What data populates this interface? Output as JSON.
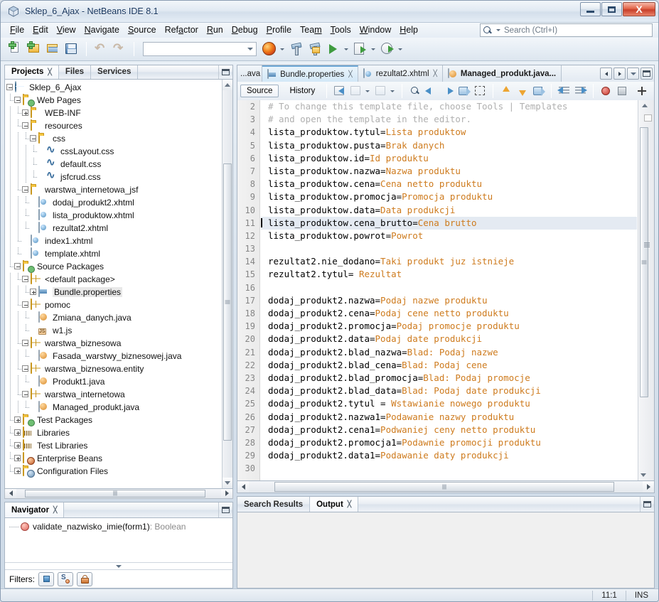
{
  "window": {
    "title": "Sklep_6_Ajax - NetBeans IDE 8.1",
    "app_icon": "netbeans-cube-icon",
    "minimize_label": "Minimize",
    "maximize_label": "Maximize",
    "close_label": "X"
  },
  "menubar": {
    "items": [
      {
        "label": "File",
        "mnemonic": "F"
      },
      {
        "label": "Edit",
        "mnemonic": "E"
      },
      {
        "label": "View",
        "mnemonic": "V"
      },
      {
        "label": "Navigate",
        "mnemonic": "N"
      },
      {
        "label": "Source",
        "mnemonic": "S"
      },
      {
        "label": "Refactor",
        "mnemonic": "a"
      },
      {
        "label": "Run",
        "mnemonic": "R"
      },
      {
        "label": "Debug",
        "mnemonic": "D"
      },
      {
        "label": "Profile",
        "mnemonic": "P"
      },
      {
        "label": "Team",
        "mnemonic": "m"
      },
      {
        "label": "Tools",
        "mnemonic": "T"
      },
      {
        "label": "Window",
        "mnemonic": "W"
      },
      {
        "label": "Help",
        "mnemonic": "H"
      }
    ]
  },
  "search": {
    "placeholder": "Search (Ctrl+I)",
    "value": "",
    "icon": "search-icon"
  },
  "toolbar": {
    "buttons": [
      {
        "name": "new-file-button",
        "icon": "new-file-icon"
      },
      {
        "name": "new-project-button",
        "icon": "new-project-icon"
      },
      {
        "name": "open-project-button",
        "icon": "open-project-icon"
      },
      {
        "name": "save-all-button",
        "icon": "save-all-icon"
      },
      {
        "name": "undo-button",
        "icon": "undo-icon"
      },
      {
        "name": "redo-button",
        "icon": "redo-icon"
      }
    ],
    "config_combo_value": "",
    "run_buttons": [
      {
        "name": "browser-button",
        "icon": "firefox-icon"
      },
      {
        "name": "build-project-button",
        "icon": "hammer-icon"
      },
      {
        "name": "clean-build-button",
        "icon": "clean-build-icon"
      },
      {
        "name": "run-project-button",
        "icon": "run-icon"
      },
      {
        "name": "debug-project-button",
        "icon": "debug-icon"
      },
      {
        "name": "profile-project-button",
        "icon": "profile-icon"
      }
    ]
  },
  "explorer": {
    "tabs": [
      {
        "label": "Projects",
        "active": true,
        "closable": true
      },
      {
        "label": "Files",
        "active": false,
        "closable": false
      },
      {
        "label": "Services",
        "active": false,
        "closable": false
      }
    ],
    "tree": [
      {
        "label": "Sklep_6_Ajax",
        "depth": 0,
        "toggle": "minus",
        "icon": "project-globe-icon"
      },
      {
        "label": "Web Pages",
        "depth": 1,
        "toggle": "minus",
        "icon": "web-pages-folder-icon"
      },
      {
        "label": "WEB-INF",
        "depth": 2,
        "toggle": "plus",
        "icon": "folder-icon"
      },
      {
        "label": "resources",
        "depth": 2,
        "toggle": "minus",
        "icon": "folder-icon"
      },
      {
        "label": "css",
        "depth": 3,
        "toggle": "minus",
        "icon": "folder-icon"
      },
      {
        "label": "cssLayout.css",
        "depth": 4,
        "toggle": "leaf",
        "icon": "css-file-icon"
      },
      {
        "label": "default.css",
        "depth": 4,
        "toggle": "leaf",
        "icon": "css-file-icon"
      },
      {
        "label": "jsfcrud.css",
        "depth": 4,
        "toggle": "leaf",
        "icon": "css-file-icon"
      },
      {
        "label": "warstwa_internetowa_jsf",
        "depth": 2,
        "toggle": "minus",
        "icon": "folder-icon"
      },
      {
        "label": "dodaj_produkt2.xhtml",
        "depth": 3,
        "toggle": "leaf",
        "icon": "xhtml-file-icon"
      },
      {
        "label": "lista_produktow.xhtml",
        "depth": 3,
        "toggle": "leaf",
        "icon": "xhtml-file-icon"
      },
      {
        "label": "rezultat2.xhtml",
        "depth": 3,
        "toggle": "leaf",
        "icon": "xhtml-file-icon"
      },
      {
        "label": "index1.xhtml",
        "depth": 2,
        "toggle": "leaf",
        "icon": "xhtml-file-icon"
      },
      {
        "label": "template.xhtml",
        "depth": 2,
        "toggle": "leaf",
        "icon": "xhtml-file-icon"
      },
      {
        "label": "Source Packages",
        "depth": 1,
        "toggle": "minus",
        "icon": "source-packages-icon"
      },
      {
        "label": "<default package>",
        "depth": 2,
        "toggle": "minus",
        "icon": "package-icon"
      },
      {
        "label": "Bundle.properties",
        "depth": 3,
        "toggle": "plus",
        "icon": "properties-file-icon",
        "selected": true
      },
      {
        "label": "pomoc",
        "depth": 2,
        "toggle": "minus",
        "icon": "package-icon"
      },
      {
        "label": "Zmiana_danych.java",
        "depth": 3,
        "toggle": "leaf",
        "icon": "java-file-icon"
      },
      {
        "label": "w1.js",
        "depth": 3,
        "toggle": "leaf",
        "icon": "js-file-icon"
      },
      {
        "label": "warstwa_biznesowa",
        "depth": 2,
        "toggle": "minus",
        "icon": "package-icon"
      },
      {
        "label": "Fasada_warstwy_biznesowej.java",
        "depth": 3,
        "toggle": "leaf",
        "icon": "java-file-icon"
      },
      {
        "label": "warstwa_biznesowa.entity",
        "depth": 2,
        "toggle": "minus",
        "icon": "package-icon"
      },
      {
        "label": "Produkt1.java",
        "depth": 3,
        "toggle": "leaf",
        "icon": "java-file-icon"
      },
      {
        "label": "warstwa_internetowa",
        "depth": 2,
        "toggle": "minus",
        "icon": "package-icon"
      },
      {
        "label": "Managed_produkt.java",
        "depth": 3,
        "toggle": "leaf",
        "icon": "java-file-icon"
      },
      {
        "label": "Test Packages",
        "depth": 1,
        "toggle": "plus",
        "icon": "test-packages-icon"
      },
      {
        "label": "Libraries",
        "depth": 1,
        "toggle": "plus",
        "icon": "libraries-icon"
      },
      {
        "label": "Test Libraries",
        "depth": 1,
        "toggle": "plus",
        "icon": "libraries-icon"
      },
      {
        "label": "Enterprise Beans",
        "depth": 1,
        "toggle": "plus",
        "icon": "enterprise-beans-icon"
      },
      {
        "label": "Configuration Files",
        "depth": 1,
        "toggle": "plus",
        "icon": "configuration-files-icon"
      }
    ]
  },
  "navigator": {
    "tab_label": "Navigator",
    "item": {
      "name": "validate_nazwisko_imie(form1)",
      "type": " : Boolean",
      "icon": "method-red-icon"
    },
    "filters_label": "Filters:",
    "filter_buttons": [
      {
        "name": "filter-non-public-button",
        "icon": "blue-square-icon"
      },
      {
        "name": "filter-static-button",
        "icon": "static-members-icon"
      },
      {
        "name": "filter-inherited-button",
        "icon": "lock-icon"
      }
    ]
  },
  "editor": {
    "tabs": [
      {
        "label": "...ava",
        "icon": "java-file-icon",
        "active": false,
        "bold": false,
        "closable": false,
        "truncated": true
      },
      {
        "label": "Bundle.properties",
        "icon": "properties-file-icon",
        "active": true,
        "bold": false,
        "closable": true
      },
      {
        "label": "rezultat2.xhtml",
        "icon": "xhtml-file-icon",
        "active": false,
        "bold": false,
        "closable": true
      },
      {
        "label": "Managed_produkt.java...",
        "icon": "java-file-icon",
        "active": false,
        "bold": true,
        "closable": false
      }
    ],
    "tab_nav": [
      {
        "name": "scroll-tabs-left-button",
        "icon": "chevron-left-icon"
      },
      {
        "name": "scroll-tabs-right-button",
        "icon": "chevron-right-icon"
      },
      {
        "name": "document-list-button",
        "icon": "chevron-down-icon"
      },
      {
        "name": "maximize-editor-button",
        "icon": "maximize-icon"
      }
    ],
    "view_tabs": [
      {
        "label": "Source",
        "active": true
      },
      {
        "label": "History",
        "active": false
      }
    ],
    "toolbar_buttons": [
      {
        "name": "last-edit-button",
        "icon": "last-edit-icon",
        "disabled": false
      },
      {
        "name": "comment-button",
        "icon": "comment-icon",
        "disabled": true
      },
      {
        "name": "uncomment-button",
        "icon": "uncomment-icon",
        "disabled": true
      },
      {
        "name": "find-selection-button",
        "icon": "find-selection-icon"
      },
      {
        "name": "previous-bookmark-button",
        "icon": "arrow-left-icon"
      },
      {
        "name": "next-bookmark-button",
        "icon": "arrow-right-icon"
      },
      {
        "name": "toggle-bookmark-button",
        "icon": "toggle-bookmark-icon"
      },
      {
        "name": "toggle-rectangular-selection-button",
        "icon": "rectangular-selection-icon"
      },
      {
        "name": "previous-error-button",
        "icon": "arrow-up-icon"
      },
      {
        "name": "next-error-button",
        "icon": "arrow-down-icon"
      },
      {
        "name": "toggle-highlight-button",
        "icon": "highlight-icon"
      },
      {
        "name": "shift-left-button",
        "icon": "shift-left-icon"
      },
      {
        "name": "shift-right-button",
        "icon": "shift-right-icon"
      },
      {
        "name": "toggle-breakpoint-button",
        "icon": "breakpoint-icon"
      },
      {
        "name": "stop-button",
        "icon": "stop-icon"
      },
      {
        "name": "toggle-non-printable-button",
        "icon": "non-printable-chars-icon"
      }
    ],
    "lines": [
      {
        "num": 2,
        "segments": [
          {
            "t": "# To change this template file, choose Tools | Templates",
            "c": "cmt"
          }
        ]
      },
      {
        "num": 3,
        "segments": [
          {
            "t": "# and open the template in the editor.",
            "c": "cmt"
          }
        ]
      },
      {
        "num": 4,
        "segments": [
          {
            "t": "lista_produktow.tytul=",
            "c": "key"
          },
          {
            "t": "Lista produktow",
            "c": "val"
          }
        ]
      },
      {
        "num": 5,
        "segments": [
          {
            "t": "lista_produktow.pusta=",
            "c": "key"
          },
          {
            "t": "Brak danych",
            "c": "val"
          }
        ]
      },
      {
        "num": 6,
        "segments": [
          {
            "t": "lista_produktow.id=",
            "c": "key"
          },
          {
            "t": "Id produktu",
            "c": "val"
          }
        ]
      },
      {
        "num": 7,
        "segments": [
          {
            "t": "lista_produktow.nazwa=",
            "c": "key"
          },
          {
            "t": "Nazwa produktu",
            "c": "val"
          }
        ]
      },
      {
        "num": 8,
        "segments": [
          {
            "t": "lista_produktow.cena=",
            "c": "key"
          },
          {
            "t": "Cena netto produktu",
            "c": "val"
          }
        ]
      },
      {
        "num": 9,
        "segments": [
          {
            "t": "lista_produktow.promocja=",
            "c": "key"
          },
          {
            "t": "Promocja produktu",
            "c": "val"
          }
        ]
      },
      {
        "num": 10,
        "segments": [
          {
            "t": "lista_produktow.data=",
            "c": "key"
          },
          {
            "t": "Data produkcji",
            "c": "val"
          }
        ]
      },
      {
        "num": 11,
        "caret": true,
        "highlight": true,
        "segments": [
          {
            "t": "lista_produktow.cena_brutto=",
            "c": "key"
          },
          {
            "t": "Cena brutto",
            "c": "val"
          }
        ]
      },
      {
        "num": 12,
        "segments": [
          {
            "t": "lista_produktow.powrot=",
            "c": "key"
          },
          {
            "t": "Powrot",
            "c": "val"
          }
        ]
      },
      {
        "num": 13,
        "segments": []
      },
      {
        "num": 14,
        "segments": [
          {
            "t": "rezultat2.nie_dodano=",
            "c": "key"
          },
          {
            "t": "Taki produkt juz istnieje",
            "c": "val"
          }
        ]
      },
      {
        "num": 15,
        "segments": [
          {
            "t": "rezultat2.tytul=",
            "c": "key"
          },
          {
            "t": " Rezultat",
            "c": "val"
          }
        ]
      },
      {
        "num": 16,
        "segments": []
      },
      {
        "num": 17,
        "segments": [
          {
            "t": "dodaj_produkt2.nazwa=",
            "c": "key"
          },
          {
            "t": "Podaj nazwe produktu",
            "c": "val"
          }
        ]
      },
      {
        "num": 18,
        "segments": [
          {
            "t": "dodaj_produkt2.cena=",
            "c": "key"
          },
          {
            "t": "Podaj cene netto produktu",
            "c": "val"
          }
        ]
      },
      {
        "num": 19,
        "segments": [
          {
            "t": "dodaj_produkt2.promocja=",
            "c": "key"
          },
          {
            "t": "Podaj promocje produktu",
            "c": "val"
          }
        ]
      },
      {
        "num": 20,
        "segments": [
          {
            "t": "dodaj_produkt2.data=",
            "c": "key"
          },
          {
            "t": "Podaj date produkcji",
            "c": "val"
          }
        ]
      },
      {
        "num": 21,
        "segments": [
          {
            "t": "dodaj_produkt2.blad_nazwa=",
            "c": "key"
          },
          {
            "t": "Blad: Podaj nazwe",
            "c": "val"
          }
        ]
      },
      {
        "num": 22,
        "segments": [
          {
            "t": "dodaj_produkt2.blad_cena=",
            "c": "key"
          },
          {
            "t": "Blad: Podaj cene",
            "c": "val"
          }
        ]
      },
      {
        "num": 23,
        "segments": [
          {
            "t": "dodaj_produkt2.blad_promocja=",
            "c": "key"
          },
          {
            "t": "Blad: Podaj promocje",
            "c": "val"
          }
        ]
      },
      {
        "num": 24,
        "segments": [
          {
            "t": "dodaj_produkt2.blad_data=",
            "c": "key"
          },
          {
            "t": "Blad: Podaj date produkcji",
            "c": "val"
          }
        ]
      },
      {
        "num": 25,
        "segments": [
          {
            "t": "dodaj_produkt2.tytul =",
            "c": "key"
          },
          {
            "t": " Wstawianie nowego produktu",
            "c": "val"
          }
        ]
      },
      {
        "num": 26,
        "segments": [
          {
            "t": "dodaj_produkt2.nazwa1=",
            "c": "key"
          },
          {
            "t": "Podawanie nazwy produktu",
            "c": "val"
          }
        ]
      },
      {
        "num": 27,
        "segments": [
          {
            "t": "dodaj_produkt2.cena1=",
            "c": "key"
          },
          {
            "t": "Podwaniej ceny netto produktu",
            "c": "val"
          }
        ]
      },
      {
        "num": 28,
        "segments": [
          {
            "t": "dodaj_produkt2.promocja1=",
            "c": "key"
          },
          {
            "t": "Podawnie promocji produktu",
            "c": "val"
          }
        ]
      },
      {
        "num": 29,
        "segments": [
          {
            "t": "dodaj_produkt2.data1=",
            "c": "key"
          },
          {
            "t": "Podawanie daty produkcji",
            "c": "val"
          }
        ]
      },
      {
        "num": 30,
        "segments": []
      }
    ]
  },
  "output_panel": {
    "tabs": [
      {
        "label": "Search Results",
        "active": false,
        "closable": false
      },
      {
        "label": "Output",
        "active": true,
        "closable": true
      }
    ],
    "content": ""
  },
  "statusbar": {
    "caret_position": "11:1",
    "insert_mode": "INS"
  },
  "colors": {
    "comment": "#b0b0b0",
    "value": "#ce7b1e",
    "key": "#000000",
    "caret_line_highlight": "#e4eaf2",
    "close_button": "#c8402b",
    "selection": "#e8e8e8"
  }
}
